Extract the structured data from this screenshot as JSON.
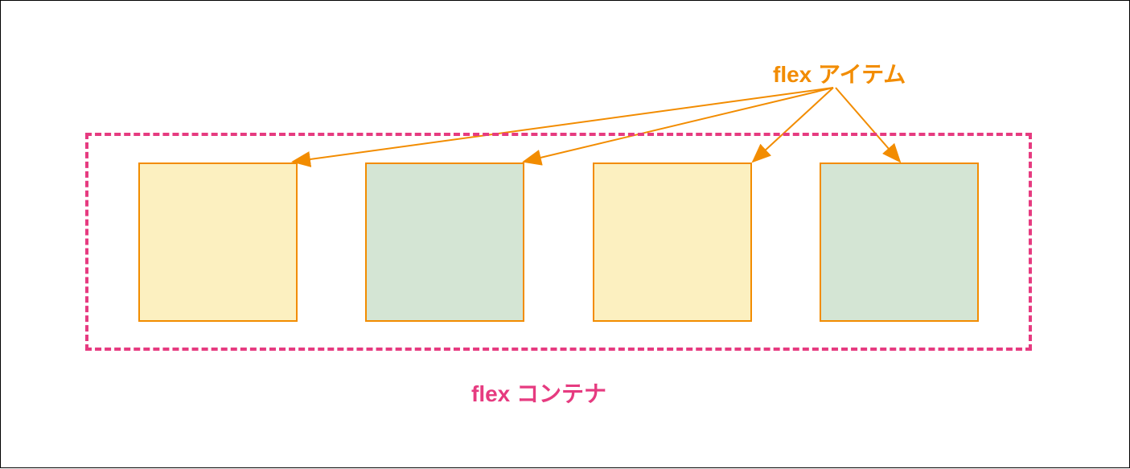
{
  "labels": {
    "items": "flex アイテム",
    "container": "flex コンテナ"
  },
  "colors": {
    "orange": "#f28c00",
    "pink": "#e63b80",
    "item_yellow": "#fcf0c0",
    "item_green": "#d4e5d4"
  },
  "diagram": {
    "type": "layout-illustration",
    "description": "CSS Flexbox container with four flex items",
    "container": {
      "border_style": "dashed",
      "border_color": "#e63b80"
    },
    "items": [
      {
        "fill": "yellow"
      },
      {
        "fill": "green"
      },
      {
        "fill": "yellow"
      },
      {
        "fill": "green"
      }
    ]
  }
}
